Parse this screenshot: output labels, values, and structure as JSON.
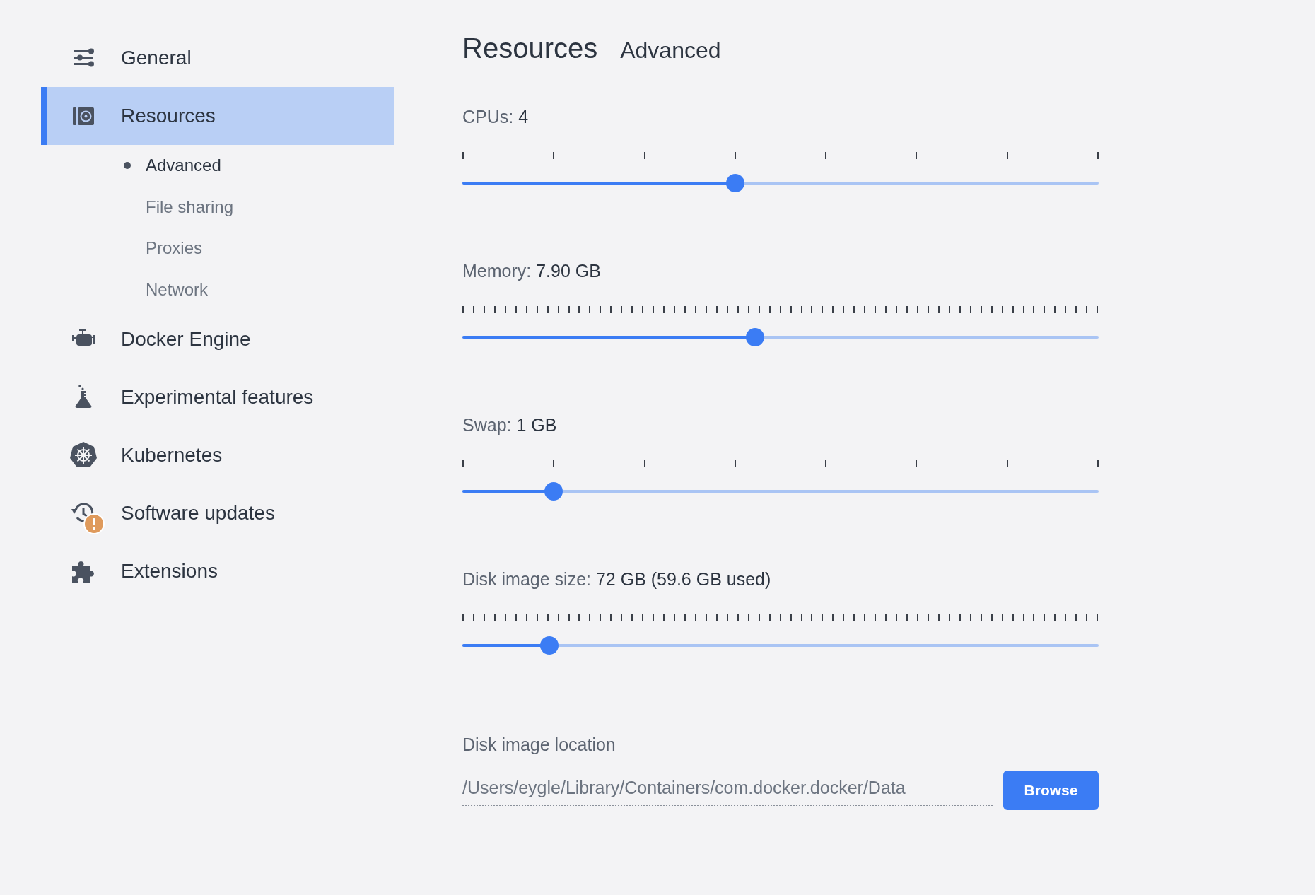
{
  "sidebar": {
    "items": [
      {
        "label": "General",
        "selected": false,
        "alert": false
      },
      {
        "label": "Resources",
        "selected": true,
        "alert": false,
        "children": [
          {
            "label": "Advanced",
            "selected": true
          },
          {
            "label": "File sharing",
            "selected": false
          },
          {
            "label": "Proxies",
            "selected": false
          },
          {
            "label": "Network",
            "selected": false
          }
        ]
      },
      {
        "label": "Docker Engine",
        "selected": false,
        "alert": false
      },
      {
        "label": "Experimental features",
        "selected": false,
        "alert": false
      },
      {
        "label": "Kubernetes",
        "selected": false,
        "alert": false
      },
      {
        "label": "Software updates",
        "selected": false,
        "alert": true
      },
      {
        "label": "Extensions",
        "selected": false,
        "alert": false
      }
    ]
  },
  "header": {
    "title": "Resources",
    "subtitle": "Advanced"
  },
  "sliders": [
    {
      "label": "CPUs:",
      "reading": "4",
      "kind": "coarse",
      "level": 0.429
    },
    {
      "label": "Memory:",
      "reading": "7.90 GB",
      "kind": "fine",
      "level": 0.46
    },
    {
      "label": "Swap:",
      "reading": "1 GB",
      "kind": "coarse",
      "level": 0.143
    },
    {
      "label": "Disk image size:",
      "reading": "72 GB (59.6 GB used)",
      "kind": "fine",
      "level": 0.137
    }
  ],
  "disk_location": {
    "label": "Disk image location",
    "value": "/Users/eygle/Library/Containers/com.docker.docker/Data",
    "button": "Browse"
  }
}
